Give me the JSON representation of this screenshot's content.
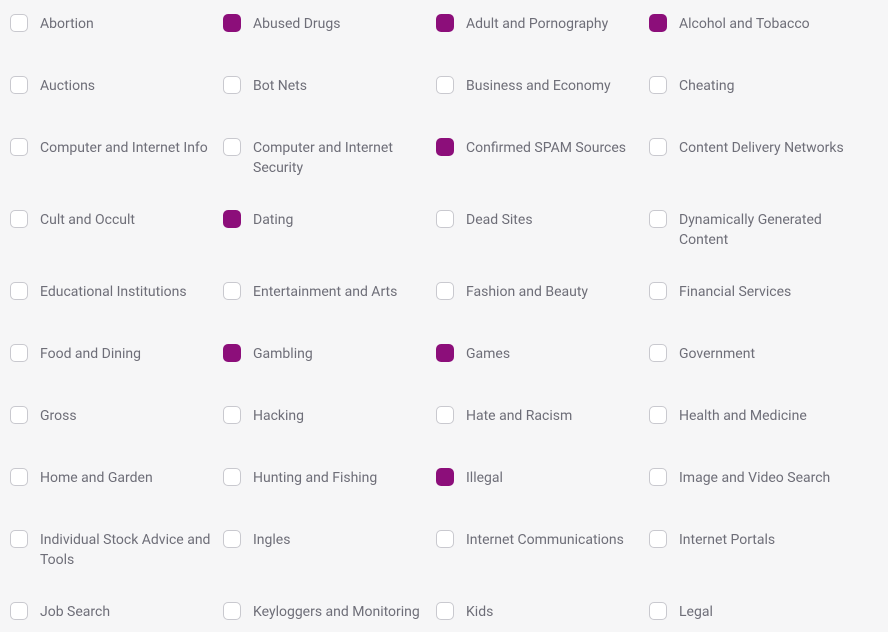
{
  "categories": [
    {
      "label": "Abortion",
      "checked": false
    },
    {
      "label": "Abused Drugs",
      "checked": true
    },
    {
      "label": "Adult and Pornography",
      "checked": true
    },
    {
      "label": "Alcohol and Tobacco",
      "checked": true
    },
    {
      "label": "Auctions",
      "checked": false
    },
    {
      "label": "Bot Nets",
      "checked": false
    },
    {
      "label": "Business and Economy",
      "checked": false
    },
    {
      "label": "Cheating",
      "checked": false
    },
    {
      "label": "Computer and Internet Info",
      "checked": false
    },
    {
      "label": "Computer and Internet Security",
      "checked": false
    },
    {
      "label": "Confirmed SPAM Sources",
      "checked": true
    },
    {
      "label": "Content Delivery Networks",
      "checked": false
    },
    {
      "label": "Cult and Occult",
      "checked": false
    },
    {
      "label": "Dating",
      "checked": true
    },
    {
      "label": "Dead Sites",
      "checked": false
    },
    {
      "label": "Dynamically Generated Content",
      "checked": false
    },
    {
      "label": "Educational Institutions",
      "checked": false
    },
    {
      "label": "Entertainment and Arts",
      "checked": false
    },
    {
      "label": "Fashion and Beauty",
      "checked": false
    },
    {
      "label": "Financial Services",
      "checked": false
    },
    {
      "label": "Food and Dining",
      "checked": false
    },
    {
      "label": "Gambling",
      "checked": true
    },
    {
      "label": "Games",
      "checked": true
    },
    {
      "label": "Government",
      "checked": false
    },
    {
      "label": "Gross",
      "checked": false
    },
    {
      "label": "Hacking",
      "checked": false
    },
    {
      "label": "Hate and Racism",
      "checked": false
    },
    {
      "label": "Health and Medicine",
      "checked": false
    },
    {
      "label": "Home and Garden",
      "checked": false
    },
    {
      "label": "Hunting and Fishing",
      "checked": false
    },
    {
      "label": "Illegal",
      "checked": true
    },
    {
      "label": "Image and Video Search",
      "checked": false
    },
    {
      "label": "Individual Stock Advice and Tools",
      "checked": false
    },
    {
      "label": "Ingles",
      "checked": false
    },
    {
      "label": "Internet Communications",
      "checked": false
    },
    {
      "label": "Internet Portals",
      "checked": false
    },
    {
      "label": "Job Search",
      "checked": false
    },
    {
      "label": "Keyloggers and Monitoring",
      "checked": false
    },
    {
      "label": "Kids",
      "checked": false
    },
    {
      "label": "Legal",
      "checked": false
    }
  ]
}
